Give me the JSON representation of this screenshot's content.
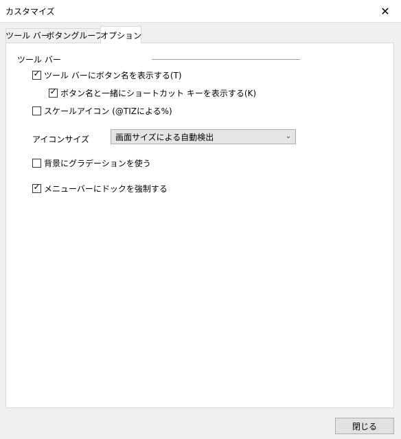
{
  "window": {
    "title": "カスタマイズ",
    "close_glyph": "✕"
  },
  "tabs": [
    {
      "label": "ツール バー",
      "active": false
    },
    {
      "label": "ボタングループ",
      "active": false
    },
    {
      "label": "オプション",
      "active": true
    }
  ],
  "toolbar_group": {
    "label": "ツール バー",
    "options": [
      {
        "label": "ツール バーにボタン名を表示する(T)",
        "checked": true
      },
      {
        "label": "ボタン名と一緒にショートカット キーを表示する(K)",
        "checked": true
      },
      {
        "label": "スケールアイコン (@TIZによる%)",
        "checked": false
      }
    ],
    "icon_size": {
      "label": "アイコンサイズ",
      "selected": "画面サイズによる自動検出"
    },
    "gradient": {
      "label": "背景にグラデーションを使う",
      "checked": false
    },
    "dock_menu": {
      "label": "メニューバーにドックを強制する",
      "checked": true
    }
  },
  "footer": {
    "close_label": "閉じる"
  },
  "icons": {
    "check": "✓",
    "chevron": "⌄"
  }
}
